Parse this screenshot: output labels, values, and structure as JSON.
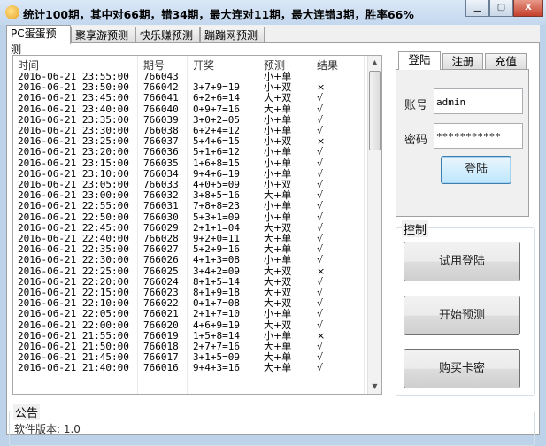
{
  "window": {
    "title": "统计100期，其中对66期，错34期，最大连对11期，最大连错3期，胜率66%",
    "minimize": "▁",
    "maximize": "▢",
    "close": "X"
  },
  "tabs": [
    "PC蛋蛋预测",
    "聚享游预测",
    "快乐赚预测",
    "蹦蹦网预测"
  ],
  "table": {
    "headers": [
      "时间",
      "期号",
      "开奖",
      "预测",
      "结果"
    ],
    "rows": [
      [
        "2016-06-21 23:55:00",
        "766043",
        "",
        "小+单",
        ""
      ],
      [
        "2016-06-21 23:50:00",
        "766042",
        "3+7+9=19",
        "小+双",
        "×"
      ],
      [
        "2016-06-21 23:45:00",
        "766041",
        "6+2+6=14",
        "大+双",
        "√"
      ],
      [
        "2016-06-21 23:40:00",
        "766040",
        "0+9+7=16",
        "大+单",
        "√"
      ],
      [
        "2016-06-21 23:35:00",
        "766039",
        "3+0+2=05",
        "小+单",
        "√"
      ],
      [
        "2016-06-21 23:30:00",
        "766038",
        "6+2+4=12",
        "小+单",
        "√"
      ],
      [
        "2016-06-21 23:25:00",
        "766037",
        "5+4+6=15",
        "小+双",
        "×"
      ],
      [
        "2016-06-21 23:20:00",
        "766036",
        "5+1+6=12",
        "小+单",
        "√"
      ],
      [
        "2016-06-21 23:15:00",
        "766035",
        "1+6+8=15",
        "小+单",
        "√"
      ],
      [
        "2016-06-21 23:10:00",
        "766034",
        "9+4+6=19",
        "小+单",
        "√"
      ],
      [
        "2016-06-21 23:05:00",
        "766033",
        "4+0+5=09",
        "小+双",
        "√"
      ],
      [
        "2016-06-21 23:00:00",
        "766032",
        "3+8+5=16",
        "大+单",
        "√"
      ],
      [
        "2016-06-21 22:55:00",
        "766031",
        "7+8+8=23",
        "小+单",
        "√"
      ],
      [
        "2016-06-21 22:50:00",
        "766030",
        "5+3+1=09",
        "小+单",
        "√"
      ],
      [
        "2016-06-21 22:45:00",
        "766029",
        "2+1+1=04",
        "大+双",
        "√"
      ],
      [
        "2016-06-21 22:40:00",
        "766028",
        "9+2+0=11",
        "大+单",
        "√"
      ],
      [
        "2016-06-21 22:35:00",
        "766027",
        "5+2+9=16",
        "大+单",
        "√"
      ],
      [
        "2016-06-21 22:30:00",
        "766026",
        "4+1+3=08",
        "小+单",
        "√"
      ],
      [
        "2016-06-21 22:25:00",
        "766025",
        "3+4+2=09",
        "大+双",
        "×"
      ],
      [
        "2016-06-21 22:20:00",
        "766024",
        "8+1+5=14",
        "大+双",
        "√"
      ],
      [
        "2016-06-21 22:15:00",
        "766023",
        "8+1+9=18",
        "大+双",
        "√"
      ],
      [
        "2016-06-21 22:10:00",
        "766022",
        "0+1+7=08",
        "大+双",
        "√"
      ],
      [
        "2016-06-21 22:05:00",
        "766021",
        "2+1+7=10",
        "小+单",
        "√"
      ],
      [
        "2016-06-21 22:00:00",
        "766020",
        "4+6+9=19",
        "大+双",
        "√"
      ],
      [
        "2016-06-21 21:55:00",
        "766019",
        "1+5+8=14",
        "小+单",
        "×"
      ],
      [
        "2016-06-21 21:50:00",
        "766018",
        "2+7+7=16",
        "大+单",
        "√"
      ],
      [
        "2016-06-21 21:45:00",
        "766017",
        "3+1+5=09",
        "大+单",
        "√"
      ],
      [
        "2016-06-21 21:40:00",
        "766016",
        "9+4+3=16",
        "大+单",
        "√"
      ]
    ]
  },
  "account": {
    "tabs": [
      "登陆",
      "注册",
      "充值"
    ],
    "account_label": "账号",
    "account_value": "admin",
    "password_label": "密码",
    "password_value": "***********",
    "login_button": "登陆"
  },
  "control": {
    "label": "控制",
    "trial_login": "试用登陆",
    "start_predict": "开始预测",
    "buy_card": "购买卡密"
  },
  "notice": {
    "label": "公告",
    "version": "软件版本: 1.0"
  }
}
